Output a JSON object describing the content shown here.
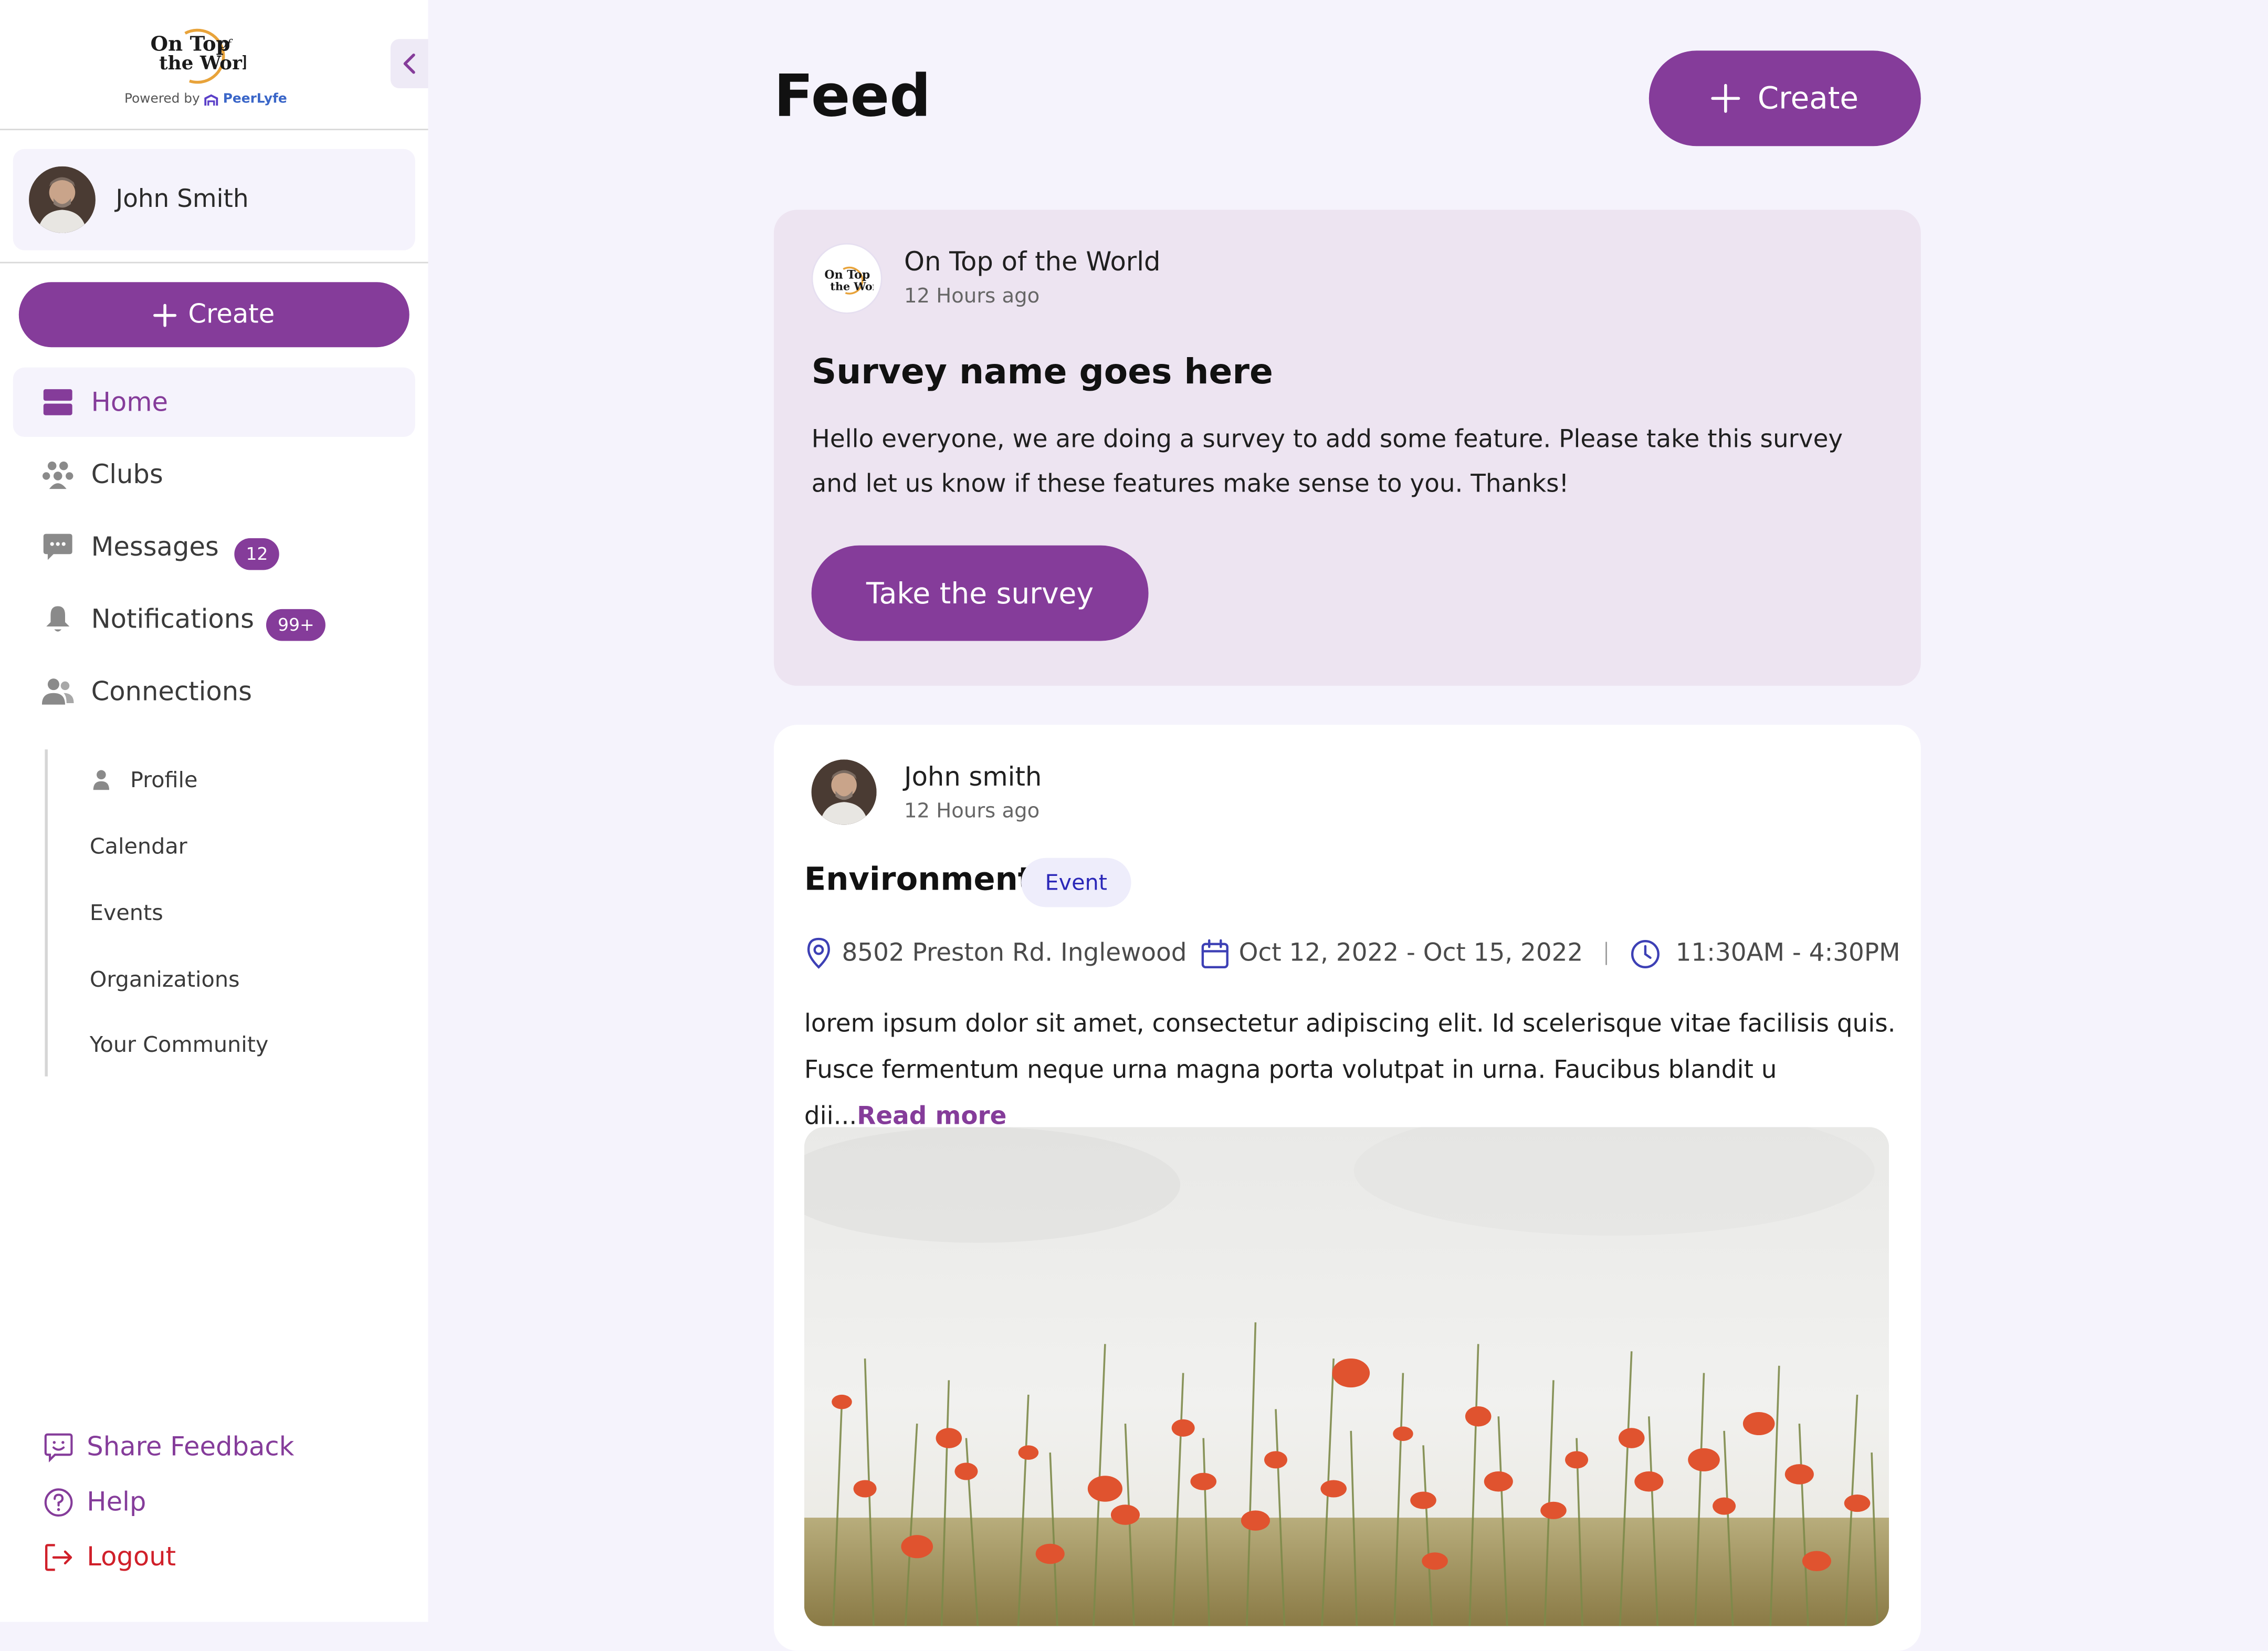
{
  "brand": {
    "logo_line1": "On Top",
    "logo_of": "of",
    "logo_line2": "the World",
    "powered_by": "Powered by",
    "powered_brand": "PeerLyfe"
  },
  "sidebar": {
    "user_name": "John Smith",
    "create_label": "Create",
    "nav": [
      {
        "label": "Home",
        "icon": "home-icon",
        "active": true
      },
      {
        "label": "Clubs",
        "icon": "clubs-icon"
      },
      {
        "label": "Messages",
        "icon": "messages-icon",
        "badge": "12"
      },
      {
        "label": "Notifications",
        "icon": "bell-icon",
        "badge": "99+"
      },
      {
        "label": "Connections",
        "icon": "connections-icon"
      }
    ],
    "sub_nav": [
      "Profile",
      "Calendar",
      "Events",
      "Organizations",
      "Your Community"
    ],
    "footer": {
      "feedback": "Share Feedback",
      "help": "Help",
      "logout": "Logout"
    }
  },
  "main": {
    "title": "Feed",
    "create_label": "Create",
    "posts": [
      {
        "author": "On Top of the World",
        "time": "12 Hours ago",
        "title": "Survey name goes here",
        "body": "Hello everyone, we are doing a survey to add some feature. Please take this survey and let us know if these features make sense to you. Thanks!",
        "button": "Take the survey"
      },
      {
        "author": "John smith",
        "time": "12 Hours ago",
        "title": "Environment",
        "tag": "Event",
        "location": "8502 Preston Rd. Inglewood",
        "dates": "Oct 12, 2022 - Oct 15, 2022",
        "time_range": "11:30AM - 4:30PM",
        "body": "lorem ipsum dolor sit amet, consectetur adipiscing elit. Id scelerisque vitae facilisis quis. Fusce fermentum neque urna magna porta volutpat in urna. Faucibus blandit u dii...",
        "read_more": "Read more"
      }
    ]
  },
  "colors": {
    "accent": "#853C9A",
    "background": "#F5F3FC",
    "survey_card": "#EDE4F1",
    "event_tag_text": "#2A27B8",
    "logout": "#D0202A"
  }
}
